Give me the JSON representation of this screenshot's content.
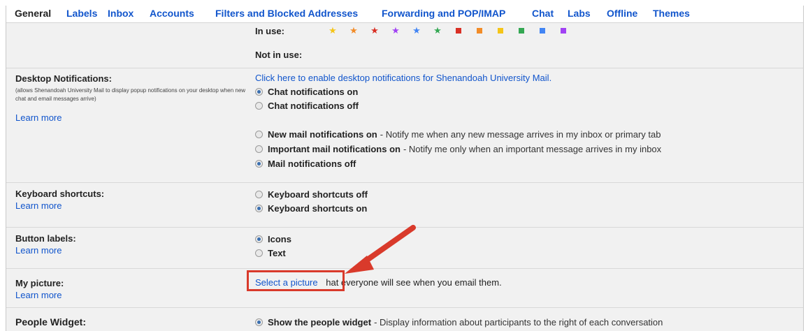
{
  "tabs": [
    "General",
    "Labels",
    "Inbox",
    "Accounts",
    "Filters and Blocked Addresses",
    "Forwarding and POP/IMAP",
    "Chat",
    "Labs",
    "Offline",
    "Themes"
  ],
  "stars": {
    "in_use_label": "In use:",
    "not_in_use_label": "Not in use:",
    "icons": [
      "yellow-star-icon",
      "orange-star-icon",
      "red-star-icon",
      "purple-star-icon",
      "blue-star-icon",
      "green-star-icon",
      "red-bang-icon",
      "orange-guillemet-icon",
      "yellow-bang-icon",
      "green-check-icon",
      "blue-info-icon",
      "purple-question-icon"
    ],
    "colors": [
      "#f5c518",
      "#f28c28",
      "#d93025",
      "#a142f4",
      "#4285f4",
      "#34a853",
      "#d93025",
      "#f28c28",
      "#f5c518",
      "#34a853",
      "#4285f4",
      "#a142f4"
    ]
  },
  "desktop_notifications": {
    "label": "Desktop Notifications:",
    "sub": "(allows Shenandoah University Mail to display popup notifications on your desktop when new chat and email messages arrive)",
    "learn_more": "Learn more",
    "enable_link": "Click here to enable desktop notifications for Shenandoah University Mail.",
    "chat_on": "Chat notifications on",
    "chat_off": "Chat notifications off",
    "new_mail_on": "New mail notifications on",
    "new_mail_on_desc": "- Notify me when any new message arrives in my inbox or primary tab",
    "important_on": "Important mail notifications on",
    "important_on_desc": "- Notify me only when an important message arrives in my inbox",
    "mail_off": "Mail notifications off"
  },
  "keyboard": {
    "label": "Keyboard shortcuts:",
    "learn_more": "Learn more",
    "off": "Keyboard shortcuts off",
    "on": "Keyboard shortcuts on"
  },
  "button_labels": {
    "label": "Button labels:",
    "learn_more": "Learn more",
    "icons": "Icons",
    "text": "Text"
  },
  "my_picture": {
    "label": "My picture:",
    "learn_more": "Learn more",
    "select": "Select a picture",
    "rest": "hat everyone will see when you email them."
  },
  "people_widget": {
    "label": "People Widget:",
    "show": "Show the people widget",
    "show_desc": "- Display information about participants to the right of each conversation"
  },
  "colors": {
    "link": "#1155cc",
    "annotation": "#d93a2b"
  }
}
